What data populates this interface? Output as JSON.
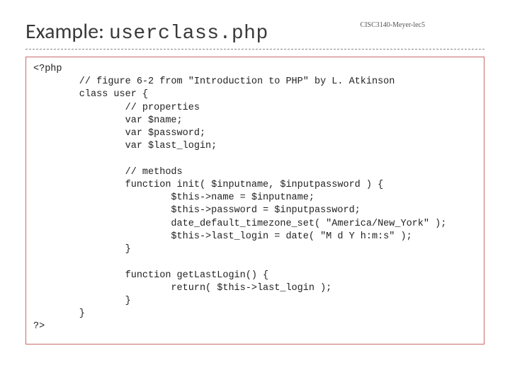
{
  "header": {
    "title_plain": "Example: ",
    "title_mono": "userclass.php",
    "course_tag": "CISC3140-Meyer-lec5"
  },
  "code": {
    "text": "<?php\n        // figure 6-2 from \"Introduction to PHP\" by L. Atkinson\n        class user {\n                // properties\n                var $name;\n                var $password;\n                var $last_login;\n\n                // methods\n                function init( $inputname, $inputpassword ) {\n                        $this->name = $inputname;\n                        $this->password = $inputpassword;\n                        date_default_timezone_set( \"America/New_York\" );\n                        $this->last_login = date( \"M d Y h:m:s\" );\n                }\n\n                function getLastLogin() {\n                        return( $this->last_login );\n                }\n        }\n?>"
  }
}
